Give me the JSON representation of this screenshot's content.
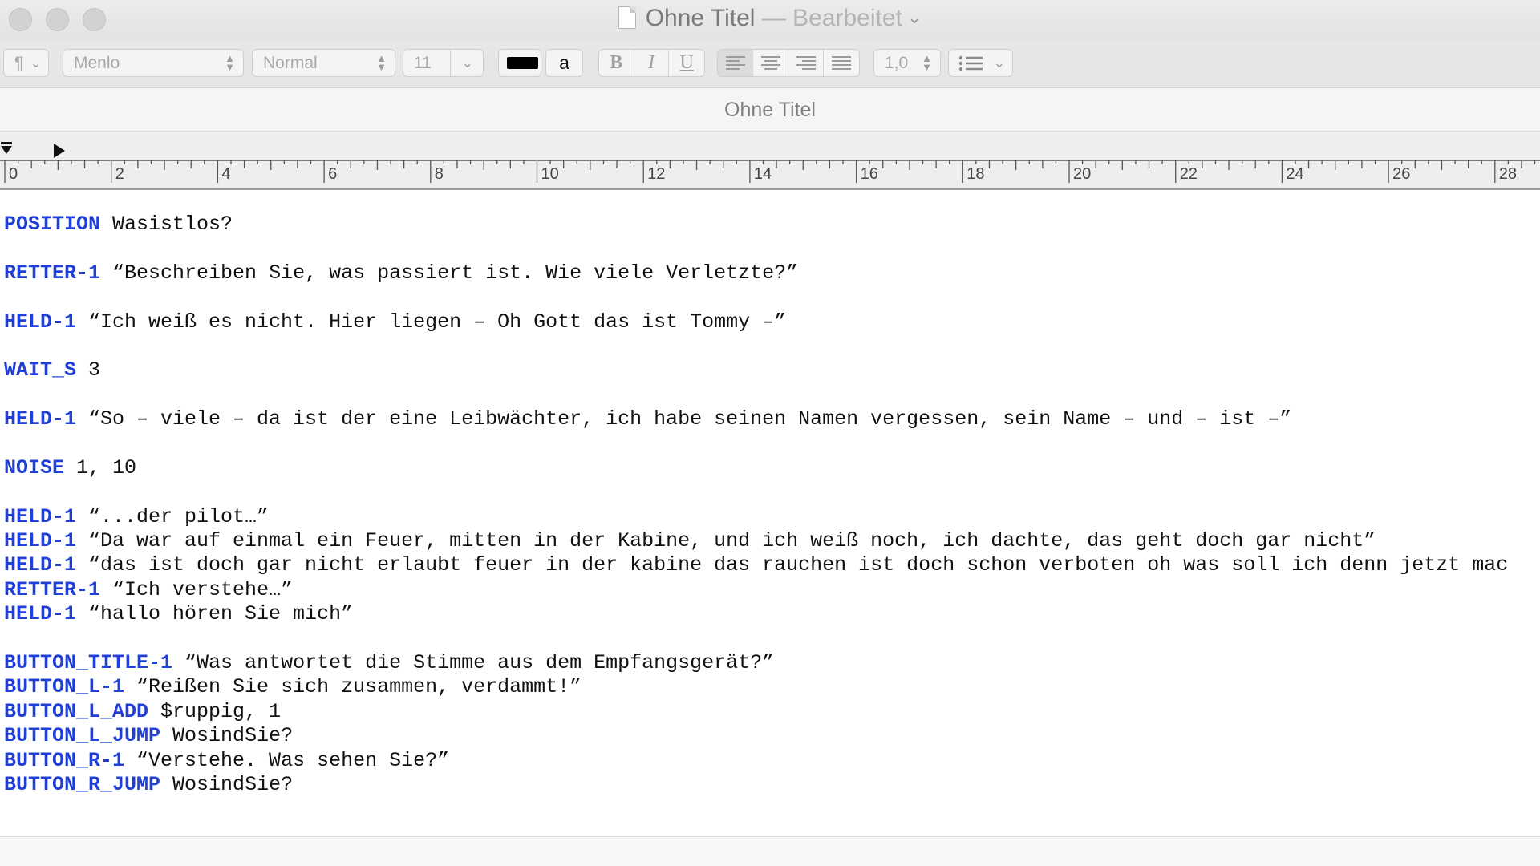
{
  "window": {
    "title": "Ohne Titel",
    "status": "— Bearbeitet"
  },
  "toolbar": {
    "paragraph_style_icon": "¶",
    "font_family": "Menlo",
    "font_style": "Normal",
    "font_size": "11",
    "text_color": "#000000",
    "highlight_label": "a",
    "bold_label": "B",
    "italic_label": "I",
    "underline_label": "U",
    "line_spacing": "1,0"
  },
  "document": {
    "header_title": "Ohne Titel"
  },
  "ruler": {
    "labels": [
      "0",
      "2",
      "4",
      "6",
      "8",
      "10",
      "12",
      "14",
      "16",
      "18",
      "20",
      "22",
      "24",
      "26",
      "28"
    ]
  },
  "colors": {
    "keyword": "#1f3fd6",
    "text": "#111111"
  },
  "lines": [
    {
      "kw": "POSITION",
      "text": " Wasistlos?"
    },
    {
      "kw": "",
      "text": ""
    },
    {
      "kw": "RETTER-1",
      "text": " “Beschreiben Sie, was passiert ist. Wie viele Verletzte?”"
    },
    {
      "kw": "",
      "text": ""
    },
    {
      "kw": "HELD-1",
      "text": " “Ich weiß es nicht. Hier liegen – Oh Gott das ist Tommy –”"
    },
    {
      "kw": "",
      "text": ""
    },
    {
      "kw": "WAIT_S",
      "text": " 3"
    },
    {
      "kw": "",
      "text": ""
    },
    {
      "kw": "HELD-1",
      "text": " “So – viele – da ist der eine Leibwächter, ich habe seinen Namen vergessen, sein Name – und – ist –”"
    },
    {
      "kw": "",
      "text": ""
    },
    {
      "kw": "NOISE",
      "text": " 1, 10"
    },
    {
      "kw": "",
      "text": ""
    },
    {
      "kw": "HELD-1",
      "text": " “...der pilot…”"
    },
    {
      "kw": "HELD-1",
      "text": " “Da war auf einmal ein Feuer, mitten in der Kabine, und ich weiß noch, ich dachte, das geht doch gar nicht”"
    },
    {
      "kw": "HELD-1",
      "text": " “das ist doch gar nicht erlaubt feuer in der kabine das rauchen ist doch schon verboten oh was soll ich denn jetzt mac"
    },
    {
      "kw": "RETTER-1",
      "text": " “Ich verstehe…”"
    },
    {
      "kw": "HELD-1",
      "text": " “hallo hören Sie mich”"
    },
    {
      "kw": "",
      "text": ""
    },
    {
      "kw": "BUTTON_TITLE-1",
      "text": " “Was antwortet die Stimme aus dem Empfangsgerät?”"
    },
    {
      "kw": "BUTTON_L-1",
      "text": " “Reißen Sie sich zusammen, verdammt!”"
    },
    {
      "kw": "BUTTON_L_ADD",
      "text": " $ruppig, 1"
    },
    {
      "kw": "BUTTON_L_JUMP",
      "text": " WosindSie?"
    },
    {
      "kw": "BUTTON_R-1",
      "text": " “Verstehe. Was sehen Sie?”"
    },
    {
      "kw": "BUTTON_R_JUMP",
      "text": " WosindSie?"
    }
  ]
}
